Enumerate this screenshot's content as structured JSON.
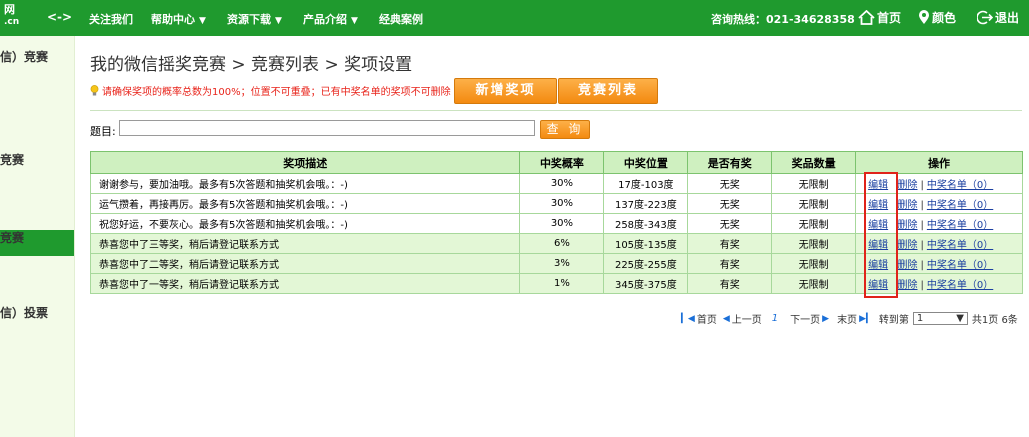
{
  "topbar": {
    "logo_line1": "网",
    "logo_line2": ".cn",
    "arrows": "<->",
    "nav": [
      {
        "label": "关注我们",
        "caret": ""
      },
      {
        "label": "帮助中心",
        "caret": "▼"
      },
      {
        "label": "资源下载",
        "caret": "▼"
      },
      {
        "label": "产品介绍",
        "caret": "▼"
      },
      {
        "label": "经典案例",
        "caret": ""
      }
    ],
    "hotline": "咨询热线：021-34628358",
    "home": "首页",
    "skin": "颜色",
    "logout": "退出"
  },
  "sidebar": {
    "items": [
      "信）竞赛",
      "竞赛",
      "竞赛",
      "信）投票"
    ]
  },
  "page": {
    "breadcrumb": "我的微信摇奖竞赛 > 竞赛列表 > 奖项设置",
    "hint": "请确保奖项的概率总数为100%；位置不可重叠；已有中奖名单的奖项不可删除",
    "add_button": "新增奖项",
    "list_button": "竞赛列表",
    "search_label": "题目:",
    "search_value": "",
    "search_button": "查 询"
  },
  "table": {
    "headers": [
      "奖项描述",
      "中奖概率",
      "中奖位置",
      "是否有奖",
      "奖品数量",
      "操作"
    ],
    "rows": [
      {
        "desc": "谢谢参与，要加油哦。最多有5次答题和抽奖机会哦。：-)",
        "prob": "30%",
        "pos": "17度-103度",
        "has": "无奖",
        "qty": "无限制"
      },
      {
        "desc": "运气攒着，再接再厉。最多有5次答题和抽奖机会哦。：-)",
        "prob": "30%",
        "pos": "137度-223度",
        "has": "无奖",
        "qty": "无限制"
      },
      {
        "desc": "祝您好运，不要灰心。最多有5次答题和抽奖机会哦。：-)",
        "prob": "30%",
        "pos": "258度-343度",
        "has": "无奖",
        "qty": "无限制"
      },
      {
        "desc": "恭喜您中了三等奖，稍后请登记联系方式",
        "prob": "6%",
        "pos": "105度-135度",
        "has": "有奖",
        "qty": "无限制"
      },
      {
        "desc": "恭喜您中了二等奖，稍后请登记联系方式",
        "prob": "3%",
        "pos": "225度-255度",
        "has": "有奖",
        "qty": "无限制"
      },
      {
        "desc": "恭喜您中了一等奖，稍后请登记联系方式",
        "prob": "1%",
        "pos": "345度-375度",
        "has": "有奖",
        "qty": "无限制"
      }
    ],
    "op_edit": "编辑",
    "op_delete": "删除",
    "op_sep": "|",
    "op_winners": "中奖名单（0）"
  },
  "pager": {
    "first": "首页",
    "prev": "上一页",
    "current": "1",
    "next": "下一页",
    "last": "末页",
    "goto": "转到第",
    "page_select": "1",
    "total": "共1页 6条"
  },
  "colors": {
    "brand_green": "#1f9a2e",
    "accent_orange": "#f38a10",
    "warning_red": "#e8241b",
    "link_blue": "#1a3fa0"
  }
}
